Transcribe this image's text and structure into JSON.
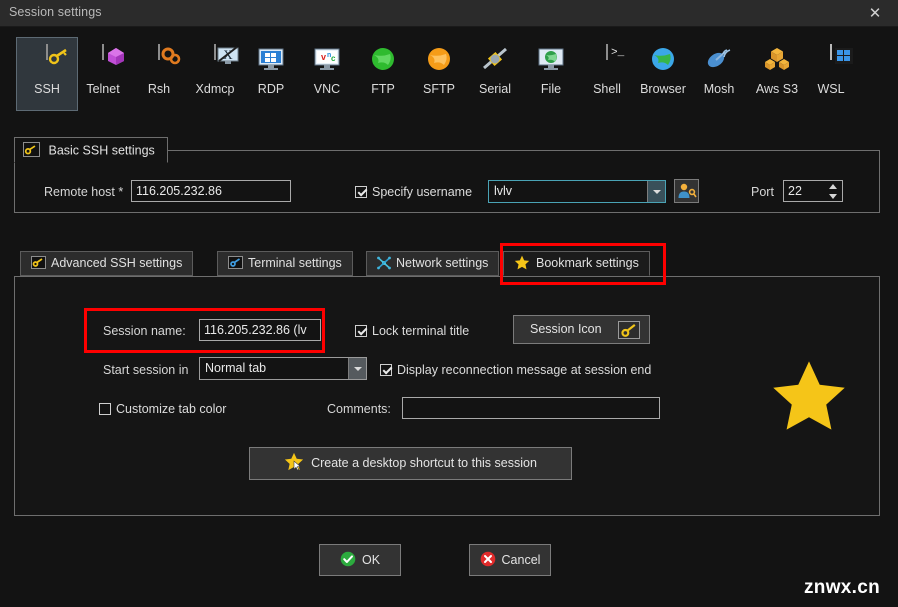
{
  "window": {
    "title": "Session settings",
    "close_label": "✕"
  },
  "protocols": [
    {
      "label": "SSH",
      "icon": "ssh-key-icon",
      "selected": true
    },
    {
      "label": "Telnet",
      "icon": "telnet-cube-icon",
      "selected": false
    },
    {
      "label": "Rsh",
      "icon": "rsh-gears-icon",
      "selected": false
    },
    {
      "label": "Xdmcp",
      "icon": "xdmcp-monitor-icon",
      "selected": false
    },
    {
      "label": "RDP",
      "icon": "rdp-windows-icon",
      "selected": false
    },
    {
      "label": "VNC",
      "icon": "vnc-monitor-icon",
      "selected": false
    },
    {
      "label": "FTP",
      "icon": "ftp-globe-icon",
      "selected": false
    },
    {
      "label": "SFTP",
      "icon": "sftp-globe-icon",
      "selected": false
    },
    {
      "label": "Serial",
      "icon": "serial-plug-icon",
      "selected": false
    },
    {
      "label": "File",
      "icon": "file-monitor-icon",
      "selected": false
    },
    {
      "label": "Shell",
      "icon": "shell-prompt-icon",
      "selected": false
    },
    {
      "label": "Browser",
      "icon": "browser-globe-icon",
      "selected": false
    },
    {
      "label": "Mosh",
      "icon": "mosh-dish-icon",
      "selected": false
    },
    {
      "label": "Aws S3",
      "icon": "aws-s3-boxes-icon",
      "selected": false
    },
    {
      "label": "WSL",
      "icon": "wsl-windows-icon",
      "selected": false
    }
  ],
  "basic": {
    "tab_label": "Basic SSH settings",
    "tab_icon": "key-icon",
    "remote_host_label": "Remote host *",
    "remote_host_value": "116.205.232.86",
    "specify_username_label": "Specify username",
    "specify_username_checked": true,
    "username_value": "lvlv",
    "user_button_icon": "user-key-icon",
    "port_label": "Port",
    "port_value": "22"
  },
  "tabs": [
    {
      "label": "Advanced SSH settings",
      "icon": "key-icon",
      "active": false
    },
    {
      "label": "Terminal settings",
      "icon": "terminal-icon",
      "active": false
    },
    {
      "label": "Network settings",
      "icon": "network-icon",
      "active": false
    },
    {
      "label": "Bookmark settings",
      "icon": "star-icon",
      "active": true
    }
  ],
  "bookmark": {
    "session_name_label": "Session name:",
    "session_name_value": "116.205.232.86 (lv",
    "lock_terminal_title_label": "Lock terminal title",
    "lock_terminal_title_checked": true,
    "session_icon_button_label": "Session Icon",
    "session_icon_glyph": "key-icon",
    "start_session_label": "Start session in",
    "start_session_value": "Normal tab",
    "display_reconnect_label": "Display reconnection message at session end",
    "display_reconnect_checked": true,
    "customize_tab_color_label": "Customize tab color",
    "customize_tab_color_checked": false,
    "comments_label": "Comments:",
    "comments_value": "",
    "shortcut_button_label": "Create a desktop shortcut to this session",
    "shortcut_button_icon": "star-cursor-icon",
    "preview_icon": "large-star-icon"
  },
  "footer": {
    "ok_label": "OK",
    "cancel_label": "Cancel",
    "watermark": "znwx.cn"
  },
  "colors": {
    "highlight": "#fe0000",
    "star": "#f5c518",
    "accent": "#4aa3b5",
    "ok_green": "#2cab3e",
    "cancel_red": "#e02b2b"
  }
}
